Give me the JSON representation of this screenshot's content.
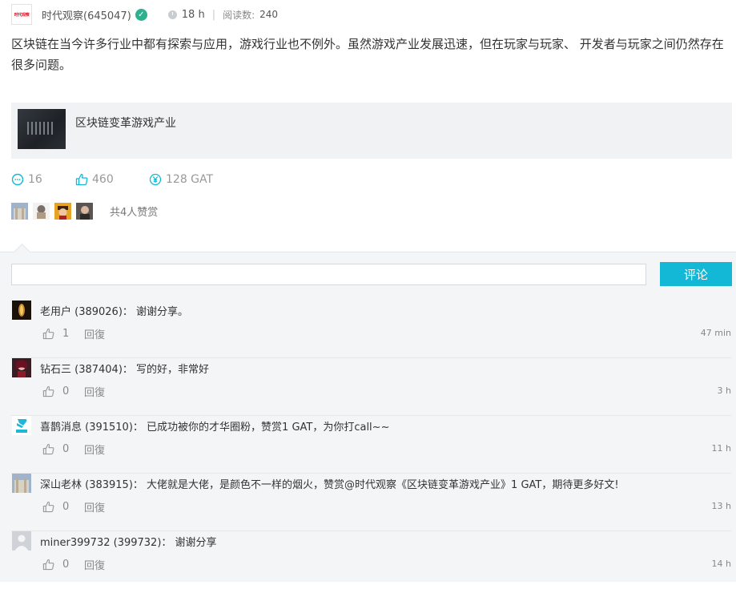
{
  "header": {
    "logo_text": "时代观察",
    "author": "时代观察(645047)",
    "time": "18 h",
    "read_label": "阅读数:",
    "read_count": "240"
  },
  "article": {
    "body": "区块链在当今许多行业中都有探索与应用，游戏行业也不例外。虽然游戏产业发展迅速，但在玩家与玩家、 开发者与玩家之间仍然存在很多问题。",
    "card_title": "区块链变革游戏产业"
  },
  "stats": {
    "comments": "16",
    "likes": "460",
    "rewards": "128 GAT"
  },
  "rewarders": {
    "summary": "共4人赞赏"
  },
  "comment_box": {
    "placeholder": "",
    "submit_label": "评论"
  },
  "comments": [
    {
      "text": "老用户 (389026)： 谢谢分享。",
      "likes": "1",
      "reply": "回復",
      "time": "47 min"
    },
    {
      "text": "钻石三 (387404)： 写的好，非常好",
      "likes": "0",
      "reply": "回復",
      "time": "3 h"
    },
    {
      "text": "喜鹊消息 (391510)： 已成功被你的才华圈粉，赞赏1 GAT，为你打call~~",
      "likes": "0",
      "reply": "回復",
      "time": "11 h"
    },
    {
      "text": "深山老林 (383915)： 大佬就是大佬，是颜色不一样的烟火，赞赏@时代观察《区块链变革游戏产业》1 GAT，期待更多好文!",
      "likes": "0",
      "reply": "回復",
      "time": "13 h"
    },
    {
      "text": "miner399732 (399732)： 谢谢分享",
      "likes": "0",
      "reply": "回復",
      "time": "14 h"
    }
  ],
  "colors": {
    "accent": "#12b8d6",
    "verified": "#2fb08e",
    "panel_bg": "#f4f5f6"
  }
}
